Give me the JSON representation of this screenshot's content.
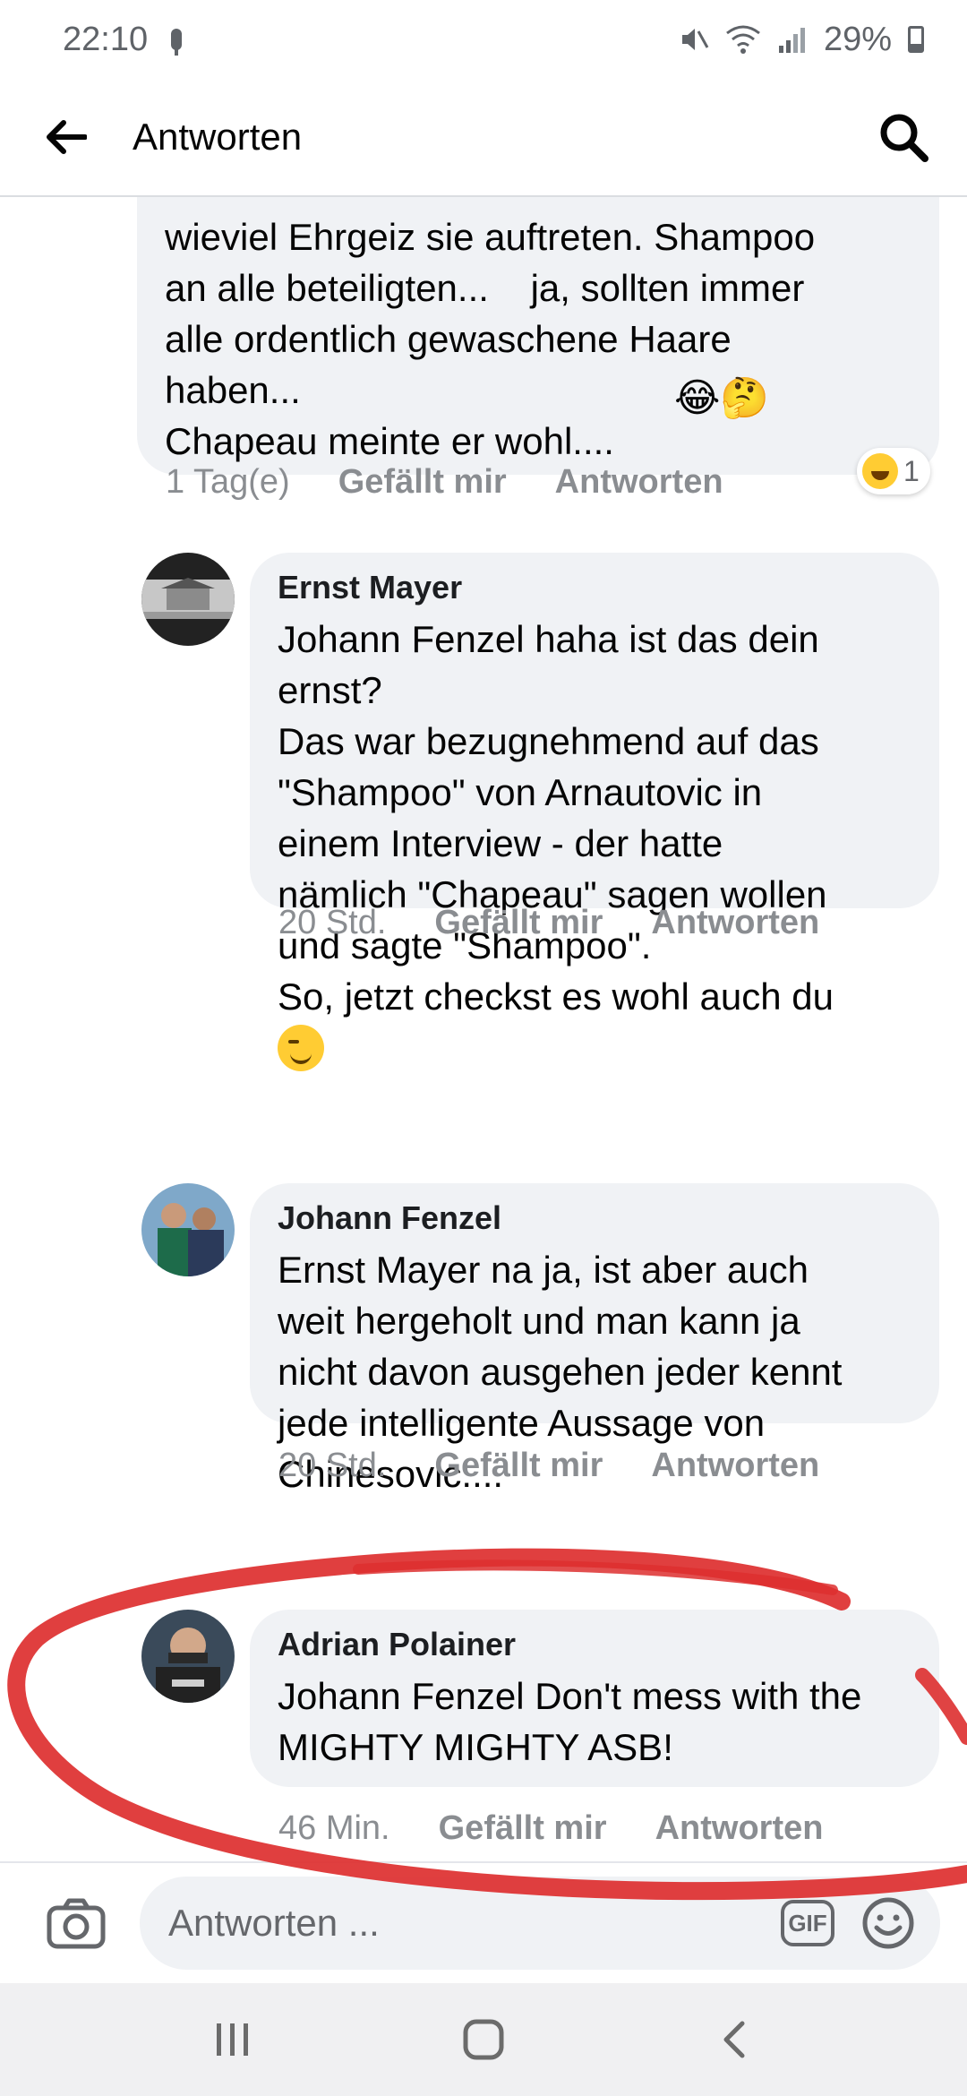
{
  "status": {
    "time": "22:10",
    "battery": "29%"
  },
  "appbar": {
    "title": "Antworten"
  },
  "comments": [
    {
      "text": "wieviel Ehrgeiz sie auftreten. Shampoo\nan alle beteiligten...    ja, sollten immer\nalle ordentlich gewaschene Haare\nhaben...\nChapeau meinte er wohl....",
      "emoji": "😂🤔",
      "time": "1 Tag(e)",
      "like": "Gefällt mir",
      "reply": "Antworten",
      "reaction_count": "1"
    },
    {
      "name": "Ernst Mayer",
      "text": "Johann Fenzel haha ist das dein\nernst?\nDas war bezugnehmend auf das\n\"Shampoo\" von Arnautovic in\neinem Interview - der hatte\nnämlich \"Chapeau\" sagen wollen\nund sagte \"Shampoo\".\nSo, jetzt checkst es wohl auch du",
      "time": "20 Std.",
      "like": "Gefällt mir",
      "reply": "Antworten"
    },
    {
      "name": "Johann Fenzel",
      "text": "Ernst Mayer na ja, ist aber auch\nweit hergeholt und man kann ja\nnicht davon ausgehen jeder kennt\njede intelligente Aussage von\nChinesovic....",
      "time": "20 Std.",
      "like": "Gefällt mir",
      "reply": "Antworten"
    },
    {
      "name": "Adrian Polainer",
      "text": "Johann Fenzel Don't mess with the\nMIGHTY MIGHTY ASB!",
      "time": "46 Min.",
      "like": "Gefällt mir",
      "reply": "Antworten"
    }
  ],
  "composer": {
    "placeholder": "Antworten ...",
    "gif_label": "GIF"
  },
  "colors": {
    "annotation": "#dd2f2f",
    "bubble": "#f0f2f5",
    "meta": "#8a8d91"
  },
  "icons": [
    "back-arrow-icon",
    "search-icon",
    "camera-icon",
    "smiley-icon",
    "recents-icon",
    "home-icon",
    "back-nav-icon"
  ]
}
